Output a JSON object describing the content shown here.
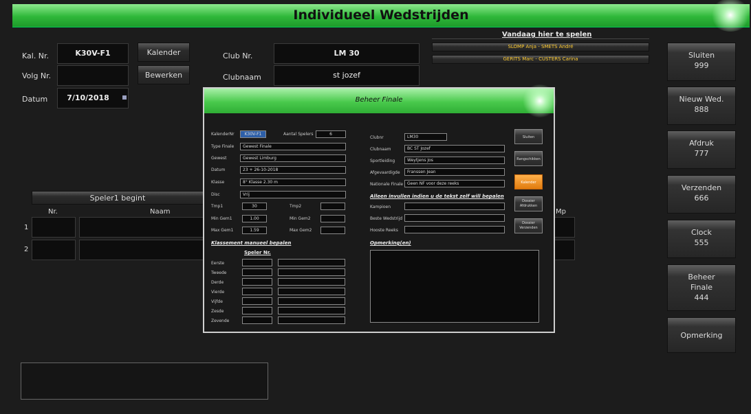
{
  "title": "Individueel Wedstrijden",
  "main": {
    "kal_nr_label": "Kal. Nr.",
    "kal_nr_value": "K30V-F1",
    "volg_nr_label": "Volg Nr.",
    "volg_nr_value": "",
    "datum_label": "Datum",
    "datum_value": "7/10/2018",
    "kalender_button": "Kalender",
    "bewerken_button": "Bewerken",
    "club_nr_label": "Club Nr.",
    "club_nr_value": "LM 30",
    "clubnaam_label": "Clubnaam",
    "clubnaam_value": "st jozef"
  },
  "today": {
    "title": "Vandaag hier te spelen",
    "matches": [
      "SLOMP Anja - SMETS André",
      "GERITS Marc - CUSTERS Carina"
    ]
  },
  "sidebar": [
    {
      "label": "Sluiten",
      "code": "999"
    },
    {
      "label": "Nieuw Wed.",
      "code": "888"
    },
    {
      "label": "Afdruk",
      "code": "777"
    },
    {
      "label": "Verzenden",
      "code": "666"
    },
    {
      "label": "Clock",
      "code": "555"
    },
    {
      "label": "Beheer\nFinale",
      "code": "444"
    },
    {
      "label": "Opmerking",
      "code": ""
    }
  ],
  "players": {
    "starts_label": "Speler1 begint",
    "col_nr": "Nr.",
    "col_naam": "Naam",
    "col_mp": "Mp",
    "rows": [
      "1",
      "2"
    ]
  },
  "modal": {
    "title": "Beheer Finale",
    "left_fields": {
      "kalendernr_label": "KalenderNr",
      "kalendernr_value": "K30V-F1",
      "aantal_spelers_label": "Aantal Spelers",
      "aantal_spelers_value": "6",
      "type_finale_label": "Type Finale",
      "type_finale_value": "Gewest Finale",
      "gewest_label": "Gewest",
      "gewest_value": "Gewest Limburg",
      "datum_label": "Datum",
      "datum_value": "23 + 26-10-2018",
      "klasse_label": "Klasse",
      "klasse_value": "8° Klasse 2.30 m",
      "disc_label": "Disc",
      "disc_value": "Vrij",
      "tmp1_label": "Tmp1",
      "tmp1_value": "30",
      "tmp2_label": "Tmp2",
      "tmp2_value": "",
      "min_gem1_label": "Min Gem1",
      "min_gem1_value": "1.00",
      "min_gem2_label": "Min Gem2",
      "min_gem2_value": "",
      "max_gem1_label": "Max Gem1",
      "max_gem1_value": "1.59",
      "max_gem2_label": "Max Gem2",
      "max_gem2_value": ""
    },
    "klassement_title": "Klassement manueel bepalen",
    "speler_nr_header": "Speler Nr.",
    "klassement_rows": [
      "Eerste",
      "Tweede",
      "Derde",
      "Vierde",
      "Vijfde",
      "Zesde",
      "Zevende"
    ],
    "right_fields": {
      "clubnr_label": "Clubnr",
      "clubnr_value": "LM30",
      "clubnaam_label": "Clubnaam",
      "clubnaam_value": "BC ST Jozef",
      "sportleiding_label": "Sportleiding",
      "sportleiding_value": "Weytjens Jos",
      "afgevaardigde_label": "Afgevaardigde",
      "afgevaardigde_value": "Franssen Jean",
      "nationale_finale_label": "Nationale Finale",
      "nationale_finale_value": "Geen NF voor deze reeks"
    },
    "alleen_title": "Alleen invullen indien u de tekst zelf will bepalen",
    "kampioen_label": "Kampioen",
    "beste_wedstrijd_label": "Beste Wedstrijd",
    "hooste_reeks_label": "Hooste Reeks",
    "opmerking_title": "Opmerking(en)",
    "buttons": {
      "sluiten": "Sluiten",
      "rangschikken": "Rangschikken",
      "kalender": "Kalender",
      "dossier_afdrukken": "Dossier\nAfdrukken",
      "dossier_verzenden": "Dossier\nVerzenden"
    }
  },
  "colors": {
    "accent_green": "#2fb83a",
    "kalender_orange": "#e8831a",
    "today_text": "#ffcc33"
  }
}
